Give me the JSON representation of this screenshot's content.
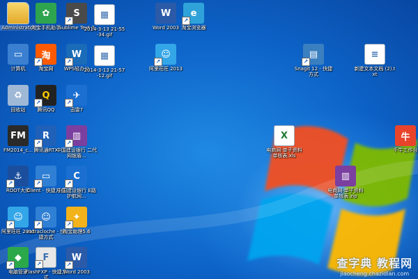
{
  "icons": [
    {
      "id": "administrator",
      "label": "Administrator",
      "icon": "folder-icon",
      "color": "#f3c54a",
      "glyph": "",
      "selected": true
    },
    {
      "id": "taobao-helper",
      "label": "淘宝手机助手",
      "icon": "pinwheel-icon",
      "color": "#2ea44f",
      "glyph": "✿"
    },
    {
      "id": "sublime",
      "label": "Sublime Text 2",
      "icon": "sublime-icon",
      "color": "#4a4a4a",
      "glyph": "S"
    },
    {
      "id": "gif1",
      "label": "2014-3-13 21-55-34.gif",
      "icon": "image-file-icon",
      "color": "#ffffff",
      "glyph": "▦"
    },
    {
      "id": "word2003",
      "label": "Word 2003",
      "icon": "word-icon",
      "color": "#2b5aa8",
      "glyph": "W"
    },
    {
      "id": "taobao-browser",
      "label": "淘宝浏览器",
      "icon": "browser-icon",
      "color": "#2fa3d9",
      "glyph": "e"
    },
    {
      "id": "computer",
      "label": "计算机",
      "icon": "computer-icon",
      "color": "#3b7fd0",
      "glyph": "▭"
    },
    {
      "id": "taobao",
      "label": "淘宝网",
      "icon": "taobao-icon",
      "color": "#ff5a00",
      "glyph": "淘"
    },
    {
      "id": "wps",
      "label": "WPS轻办公",
      "icon": "wps-icon",
      "color": "#1a6bb8",
      "glyph": "W"
    },
    {
      "id": "gif2",
      "label": "2014-3-13 21-57-12.gif",
      "icon": "image-file-icon",
      "color": "#ffffff",
      "glyph": "▦"
    },
    {
      "id": "aliwangwang1",
      "label": "阿里旺旺 2013",
      "icon": "wangwang-icon",
      "color": "#33a6e8",
      "glyph": "☺"
    },
    {
      "id": "snagit",
      "label": "Snagit 12 - 快捷方式",
      "icon": "snagit-icon",
      "color": "#3a7fc0",
      "glyph": "▤"
    },
    {
      "id": "newtxt",
      "label": "新建文本文档 (2).txt",
      "icon": "text-file-icon",
      "color": "#ffffff",
      "glyph": "≡"
    },
    {
      "id": "recycle",
      "label": "回收站",
      "icon": "recycle-bin-icon",
      "color": "#9fb8d6",
      "glyph": "♻"
    },
    {
      "id": "qq",
      "label": "腾讯QQ",
      "icon": "qq-penguin-icon",
      "color": "#222222",
      "glyph": "Q"
    },
    {
      "id": "xunlei",
      "label": "迅雷7",
      "icon": "thunder-icon",
      "color": "#1a6fd1",
      "glyph": "✈"
    },
    {
      "id": "fm2014",
      "label": "FM2014_c...",
      "icon": "fm-icon",
      "color": "#2a2a2a",
      "glyph": "FM"
    },
    {
      "id": "rtx",
      "label": "腾讯通RTX",
      "icon": "rtx-icon",
      "color": "#1f60b8",
      "glyph": "R"
    },
    {
      "id": "ccb1",
      "label": "中国建设银行 二代网银盾...",
      "icon": "rar-icon",
      "color": "#7b3fa0",
      "glyph": "▥"
    },
    {
      "id": "xls",
      "label": "电商网·单子资料 单核表.xls",
      "icon": "excel-file-icon",
      "color": "#ffffff",
      "glyph": "X"
    },
    {
      "id": "qianniu",
      "label": "千牛工作台",
      "icon": "qianniu-icon",
      "color": "#e8442c",
      "glyph": "牛"
    },
    {
      "id": "root",
      "label": "ROOT大师",
      "icon": "anchor-icon",
      "color": "#1b4f9e",
      "glyph": "⚓"
    },
    {
      "id": "client",
      "label": "Client - 快捷方式",
      "icon": "client-icon",
      "color": "#2f7fd4",
      "glyph": "▭"
    },
    {
      "id": "ccb2",
      "label": "中国建设银行 E路护航网...",
      "icon": "ccb-icon",
      "color": "#1a6fd1",
      "glyph": "C"
    },
    {
      "id": "zip",
      "label": "电商网·单子资料 单核表.zip",
      "icon": "rar-icon",
      "color": "#7b3fa0",
      "glyph": "▥"
    },
    {
      "id": "aliwangwang2",
      "label": "阿里旺旺 2013",
      "icon": "wangwang-icon",
      "color": "#33a6e8",
      "glyph": "☺"
    },
    {
      "id": "extracloche",
      "label": "extracloche - 快捷方式",
      "icon": "extracloche-icon",
      "color": "#2f7fd4",
      "glyph": "☺"
    },
    {
      "id": "taobao-wizard",
      "label": "淘宝助理5.6",
      "icon": "wizard-icon",
      "color": "#f2b21b",
      "glyph": "✦"
    },
    {
      "id": "diannao-guanjia",
      "label": "电脑管家",
      "icon": "shield-icon",
      "color": "#2aa84a",
      "glyph": "◆"
    },
    {
      "id": "flashfxp",
      "label": "FlashFXP - 快捷方式",
      "icon": "flashfxp-icon",
      "color": "#e8e8e8",
      "glyph": "F"
    },
    {
      "id": "word2003b",
      "label": "Word 2003",
      "icon": "word-icon",
      "color": "#2b5aa8",
      "glyph": "W"
    }
  ],
  "watermark": {
    "line1": "查字典 教程网",
    "line2": "jiaocheng.chazidian.com"
  }
}
